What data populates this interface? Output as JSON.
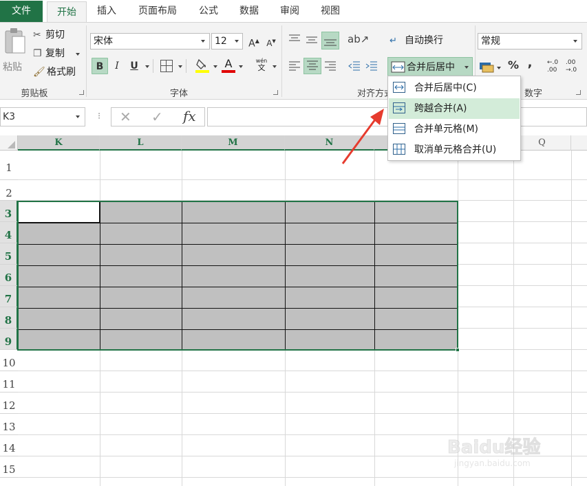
{
  "tabs": [
    {
      "label": "文件",
      "key": "file"
    },
    {
      "label": "开始",
      "key": "home"
    },
    {
      "label": "插入",
      "key": "insert"
    },
    {
      "label": "页面布局",
      "key": "layout"
    },
    {
      "label": "公式",
      "key": "formulas"
    },
    {
      "label": "数据",
      "key": "data"
    },
    {
      "label": "审阅",
      "key": "review"
    },
    {
      "label": "视图",
      "key": "view"
    }
  ],
  "clipboard": {
    "paste_label": "粘贴",
    "cut_label": "剪切",
    "copy_label": "复制",
    "format_painter_label": "格式刷",
    "group_label": "剪贴板"
  },
  "font": {
    "font_name": "宋体",
    "font_size": "12",
    "grow_label": "A",
    "shrink_label": "A",
    "bold_label": "B",
    "italic_label": "I",
    "underline_label": "U",
    "fill_label": "",
    "font_color_label": "A",
    "phonetic_top": "wén",
    "phonetic_bottom": "文",
    "group_label": "字体"
  },
  "alignment": {
    "wrap_text_label": "自动换行",
    "merge_center_label": "合并后居中",
    "group_label": "对齐方式"
  },
  "number": {
    "format": "常规",
    "percent_label": "%",
    "comma_label": ",",
    "inc_top": "←.0",
    "inc_bottom": ".00",
    "dec_top": ".00",
    "dec_bottom": "→.0",
    "group_label": "数字"
  },
  "formula_bar": {
    "name_box": "K3",
    "fx_label": "fx",
    "formula": ""
  },
  "columns": [
    "K",
    "L",
    "M",
    "N",
    "",
    "Q"
  ],
  "rows": [
    "1",
    "2",
    "3",
    "4",
    "5",
    "6",
    "7",
    "8",
    "9",
    "10",
    "11",
    "12",
    "13",
    "14",
    "15"
  ],
  "merge_menu": [
    {
      "label": "合并后居中(C)"
    },
    {
      "label": "跨越合并(A)"
    },
    {
      "label": "合并单元格(M)"
    },
    {
      "label": "取消单元格合并(U)"
    }
  ],
  "watermark": {
    "brand": "Baidu经验",
    "url": "jingyan.baidu.com"
  },
  "colors": {
    "accent": "#217346",
    "selection_fill": "#c0c0c0",
    "menu_hover": "#d3ecd9",
    "arrow": "#e63b2e"
  }
}
